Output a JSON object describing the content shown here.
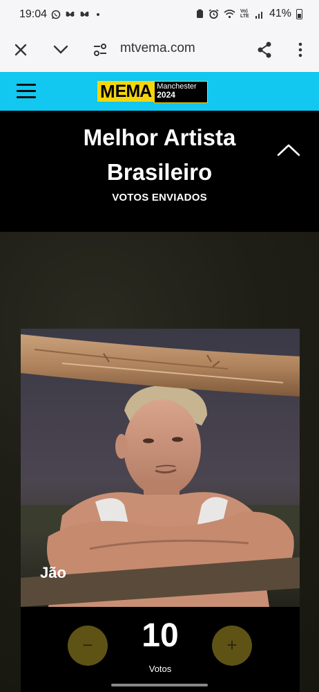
{
  "status_bar": {
    "time": "19:04",
    "left_icons": [
      "whatsapp-icon",
      "butterfly-icon",
      "butterfly-icon",
      "dot-icon"
    ],
    "right_icons": [
      "clipboard-icon",
      "alarm-icon",
      "wifi-icon",
      "volte-icon",
      "signal-icon"
    ],
    "network_label": "Vo) LTE",
    "battery": "41%"
  },
  "browser": {
    "url": "mtvema.com",
    "close_icon": "close-icon",
    "menu_icon": "chevron-down-icon"
  },
  "site_header": {
    "logo_text": "EMA",
    "logo_mark": "M",
    "logo_city": "Manchester",
    "logo_year": "2024",
    "brand_color": "#12c7f0",
    "accent_color": "#f5d60c"
  },
  "category": {
    "title": "Melhor Artista Brasileiro",
    "status": "VOTOS ENVIADOS"
  },
  "nominee": {
    "name": "Jão",
    "votes": "10",
    "votes_label": "Votos",
    "decrement_label": "−",
    "increment_label": "+"
  }
}
